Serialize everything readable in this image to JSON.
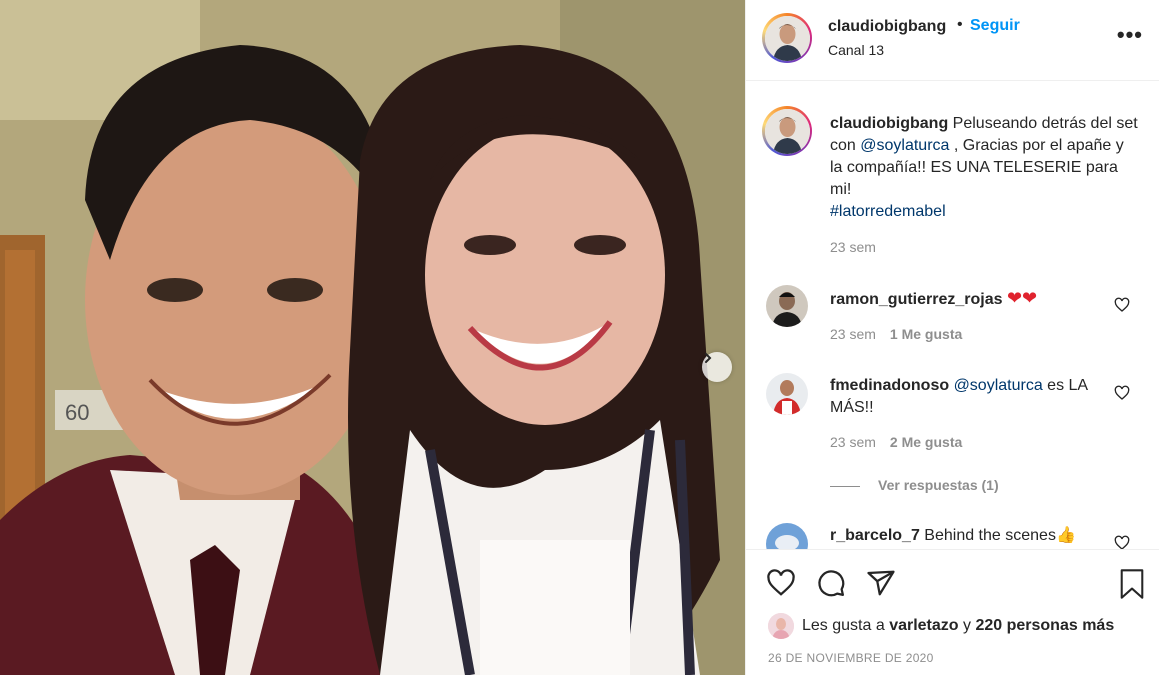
{
  "post": {
    "image_description_icon": "photo",
    "carousel_next_icon": "chevron-right-icon"
  },
  "header": {
    "username": "claudiobigbang",
    "dot": "•",
    "follow_label": "Seguir",
    "location": "Canal 13",
    "more_icon": "more-horizontal-icon"
  },
  "caption": {
    "username": "claudiobigbang",
    "text_1": "Peluseando detrás del set con ",
    "mention": "@soylaturca",
    "text_2": " , Gracias por el apañe y la compañía!! ES UNA TELESERIE para mi!",
    "hashtag": "#latorredemabel",
    "time": "23 sem"
  },
  "comments": [
    {
      "username": "ramon_gutierrez_rojas",
      "text": "",
      "emoji": "❤❤",
      "time": "23 sem",
      "likes": "1 Me gusta"
    },
    {
      "username": "fmedinadonoso",
      "mention": "@soylaturca",
      "text": " es LA MÁS!!",
      "time": "23 sem",
      "likes": "2 Me gusta",
      "replies": "Ver respuestas (1)"
    },
    {
      "username": "r_barcelo_7",
      "text": " Behind the scenes👍"
    }
  ],
  "actions": {
    "likes_prefix": "Les gusta a ",
    "liker": "varletazo",
    "likes_mid": " y ",
    "others": "220 personas más",
    "date": "26 DE NOVIEMBRE DE 2020"
  },
  "colors": {
    "accent": "#0095f6",
    "link": "#00376b",
    "muted": "#8e8e8e"
  }
}
